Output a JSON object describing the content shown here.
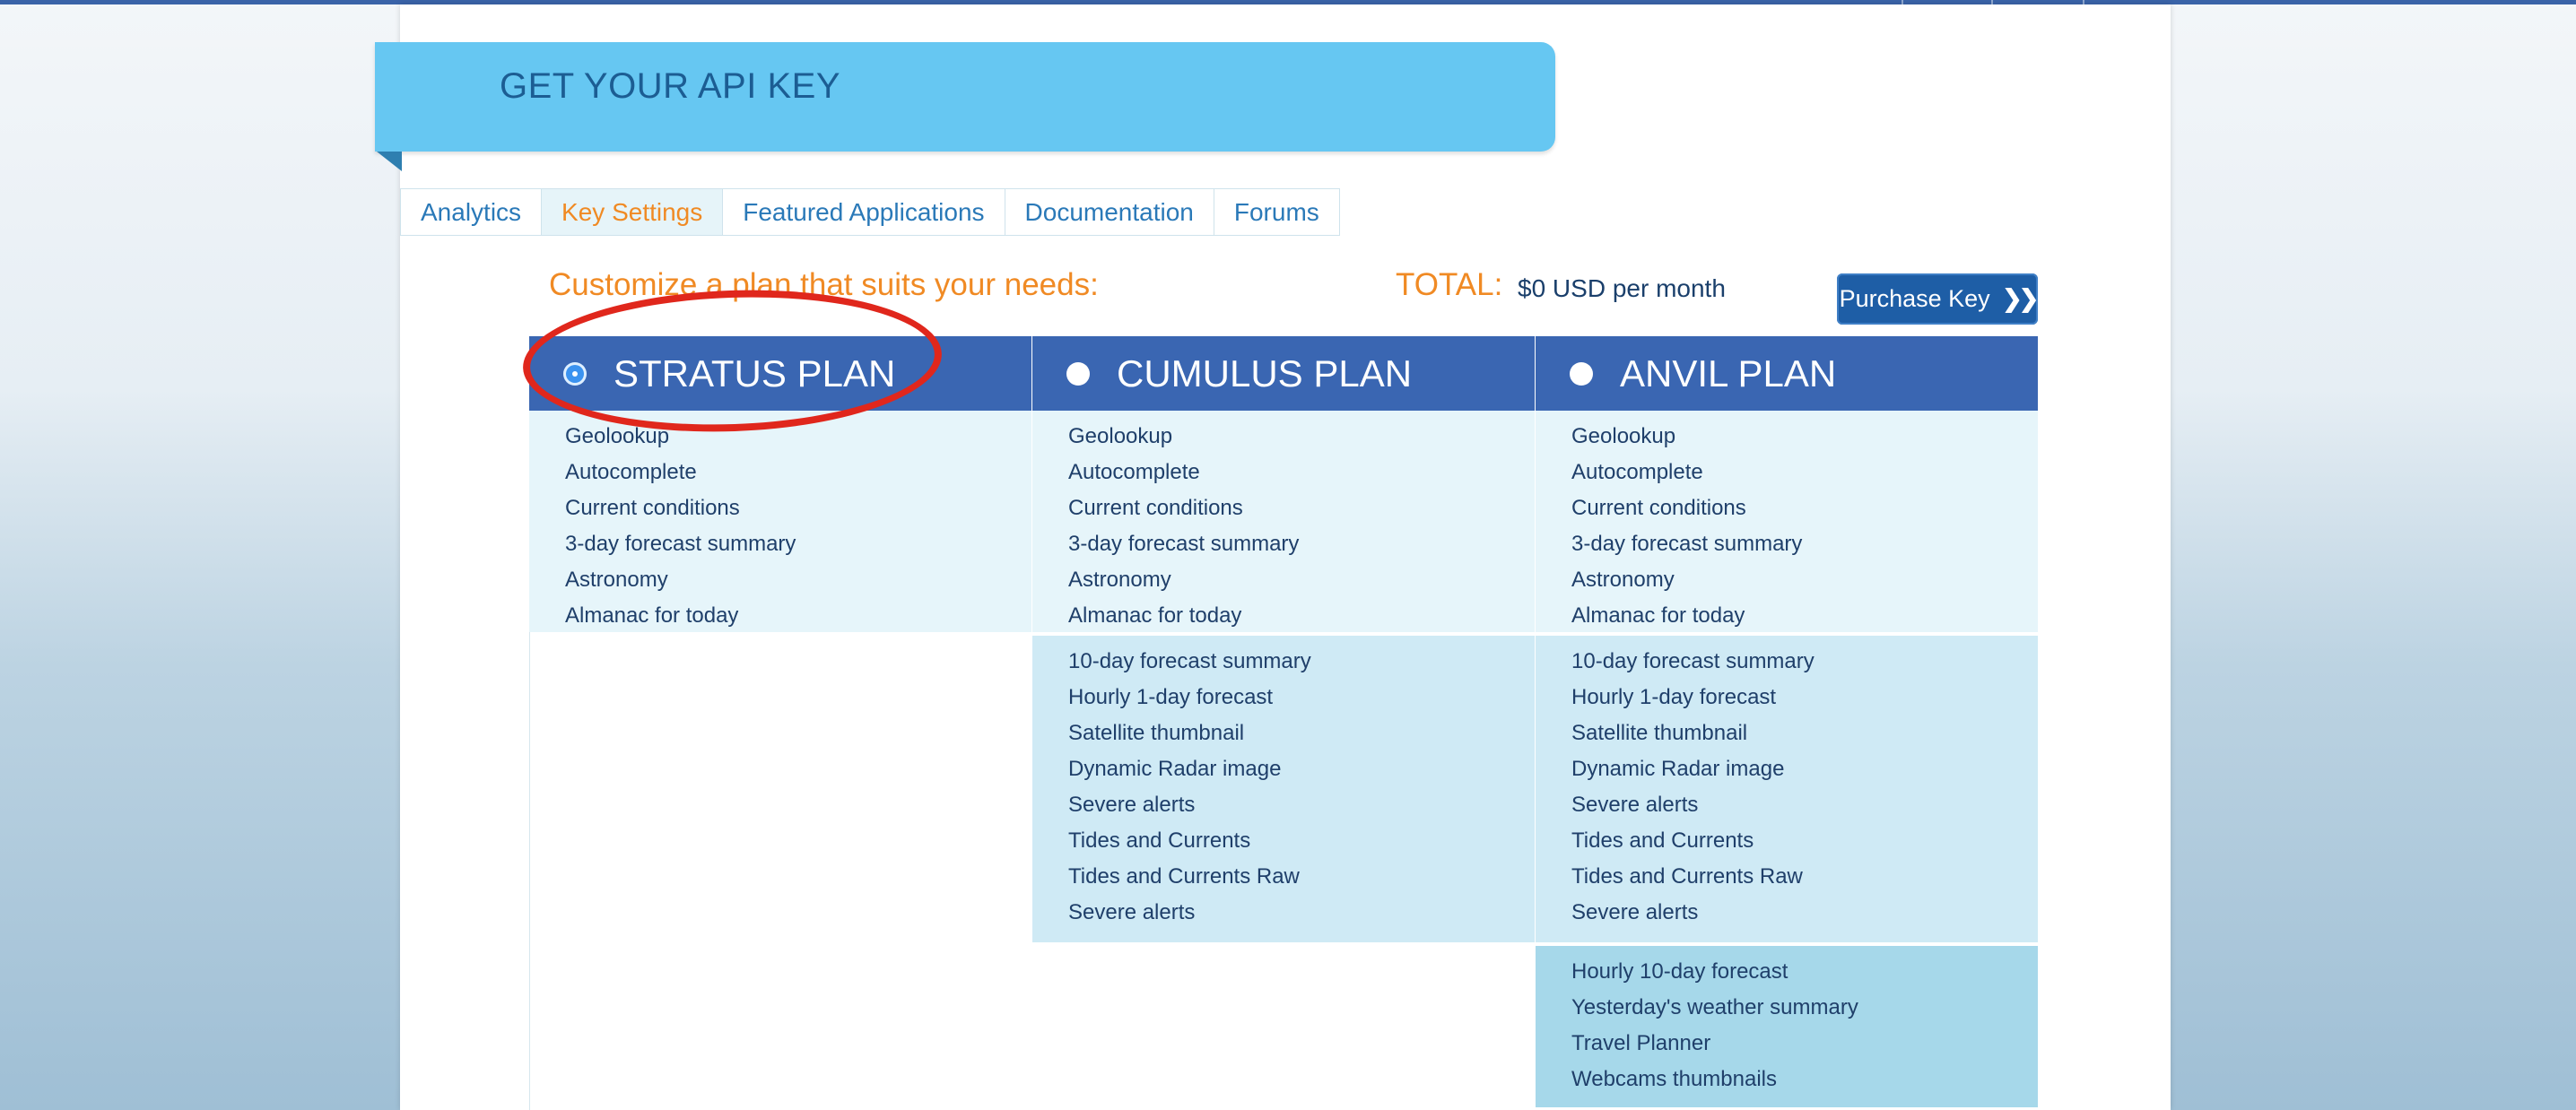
{
  "header": {
    "title": "GET YOUR API KEY"
  },
  "tabs": [
    {
      "label": "Analytics",
      "active": false
    },
    {
      "label": "Key Settings",
      "active": true
    },
    {
      "label": "Featured Applications",
      "active": false
    },
    {
      "label": "Documentation",
      "active": false
    },
    {
      "label": "Forums",
      "active": false
    }
  ],
  "pricing": {
    "customize_text": "Customize a plan that suits your needs:",
    "total_label": "TOTAL:",
    "total_value": "$0 USD per month",
    "purchase_label": "Purchase Key",
    "purchase_icon": "double-chevron-right-icon"
  },
  "plans": [
    {
      "name": "STRATUS PLAN",
      "selected": true,
      "groups": [
        [
          "Geolookup",
          "Autocomplete",
          "Current conditions",
          "3-day forecast summary",
          "Astronomy",
          "Almanac for today"
        ]
      ]
    },
    {
      "name": "CUMULUS PLAN",
      "selected": false,
      "groups": [
        [
          "Geolookup",
          "Autocomplete",
          "Current conditions",
          "3-day forecast summary",
          "Astronomy",
          "Almanac for today"
        ],
        [
          "10-day forecast summary",
          "Hourly 1-day forecast",
          "Satellite thumbnail",
          "Dynamic Radar image",
          "Severe alerts",
          "Tides and Currents",
          "Tides and Currents Raw",
          "Severe alerts"
        ]
      ]
    },
    {
      "name": "ANVIL PLAN",
      "selected": false,
      "groups": [
        [
          "Geolookup",
          "Autocomplete",
          "Current conditions",
          "3-day forecast summary",
          "Astronomy",
          "Almanac for today"
        ],
        [
          "10-day forecast summary",
          "Hourly 1-day forecast",
          "Satellite thumbnail",
          "Dynamic Radar image",
          "Severe alerts",
          "Tides and Currents",
          "Tides and Currents Raw",
          "Severe alerts"
        ],
        [
          "Hourly 10-day forecast",
          "Yesterday's weather summary",
          "Travel Planner",
          "Webcams thumbnails"
        ]
      ]
    }
  ],
  "colors": {
    "accent_orange": "#f08a24",
    "plan_header_blue": "#3a66b2",
    "banner_blue": "#66c7f2",
    "annotation_red": "#e0271c"
  }
}
